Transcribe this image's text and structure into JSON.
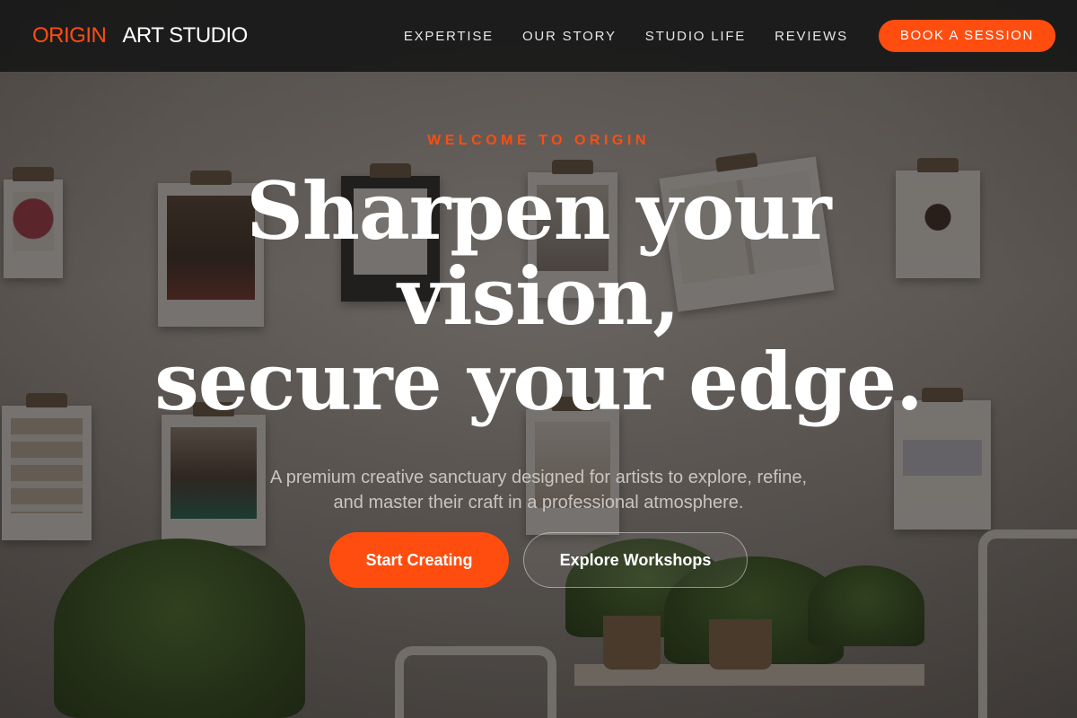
{
  "brand": {
    "mark": "ORIGIN",
    "name": "ART STUDIO",
    "accent_color": "#ff4d0f"
  },
  "nav": {
    "items": [
      {
        "label": "EXPERTISE"
      },
      {
        "label": "OUR STORY"
      },
      {
        "label": "STUDIO LIFE"
      },
      {
        "label": "REVIEWS"
      }
    ],
    "cta_label": "BOOK A SESSION"
  },
  "hero": {
    "eyebrow": "WELCOME TO ORIGIN",
    "headline_lines": [
      "Sharpen your",
      "vision,",
      "secure your edge."
    ],
    "subtitle_lines": [
      "A premium creative sanctuary designed for artists to explore, refine,",
      "and master their craft in a professional atmosphere."
    ],
    "primary_button": "Start Creating",
    "secondary_button": "Explore Workshops"
  }
}
